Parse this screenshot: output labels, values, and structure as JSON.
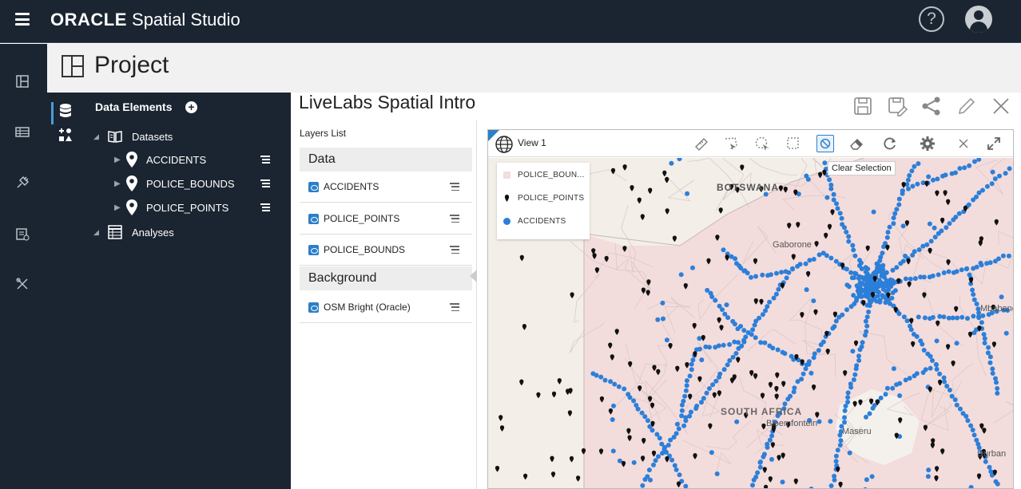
{
  "app": {
    "brand_oracle": "ORACLE",
    "brand_product": "Spatial Studio",
    "help_label": "?"
  },
  "project": {
    "title": "Project"
  },
  "data_elements": {
    "title": "Data Elements",
    "add_label": "+",
    "datasets_label": "Datasets",
    "datasets": [
      {
        "name": "ACCIDENTS"
      },
      {
        "name": "POLICE_BOUNDS"
      },
      {
        "name": "POLICE_POINTS"
      }
    ],
    "analyses_label": "Analyses"
  },
  "main": {
    "title": "LiveLabs Spatial Intro"
  },
  "layers": {
    "title": "Layers List",
    "data_section": "Data",
    "data_layers": [
      {
        "name": "ACCIDENTS"
      },
      {
        "name": "POLICE_POINTS"
      },
      {
        "name": "POLICE_BOUNDS"
      }
    ],
    "background_section": "Background",
    "background_layers": [
      {
        "name": "OSM Bright (Oracle)"
      }
    ]
  },
  "map": {
    "view_title": "View 1",
    "tooltip": "Clear Selection",
    "legend": [
      {
        "label": "POLICE_BOUN...",
        "color": "#f2dede"
      },
      {
        "label": "POLICE_POINTS",
        "color": "#111111"
      },
      {
        "label": "ACCIDENTS",
        "color": "#2c7fd9"
      }
    ],
    "place_labels": {
      "botswana": "BOTSWANA",
      "gaborone": "Gaborone",
      "south_africa": "SOUTH AFRICA",
      "bloemfontein": "Bloemfontein",
      "maseru": "Maseru",
      "mbabane": "Mbabane",
      "durban": "Durban"
    },
    "colors": {
      "land": "#f3eee7",
      "police_bounds_fill": "#f3dcdc",
      "accidents": "#2c7fd9",
      "police_points": "#111111",
      "lesotho": "#f4f1ec"
    }
  }
}
